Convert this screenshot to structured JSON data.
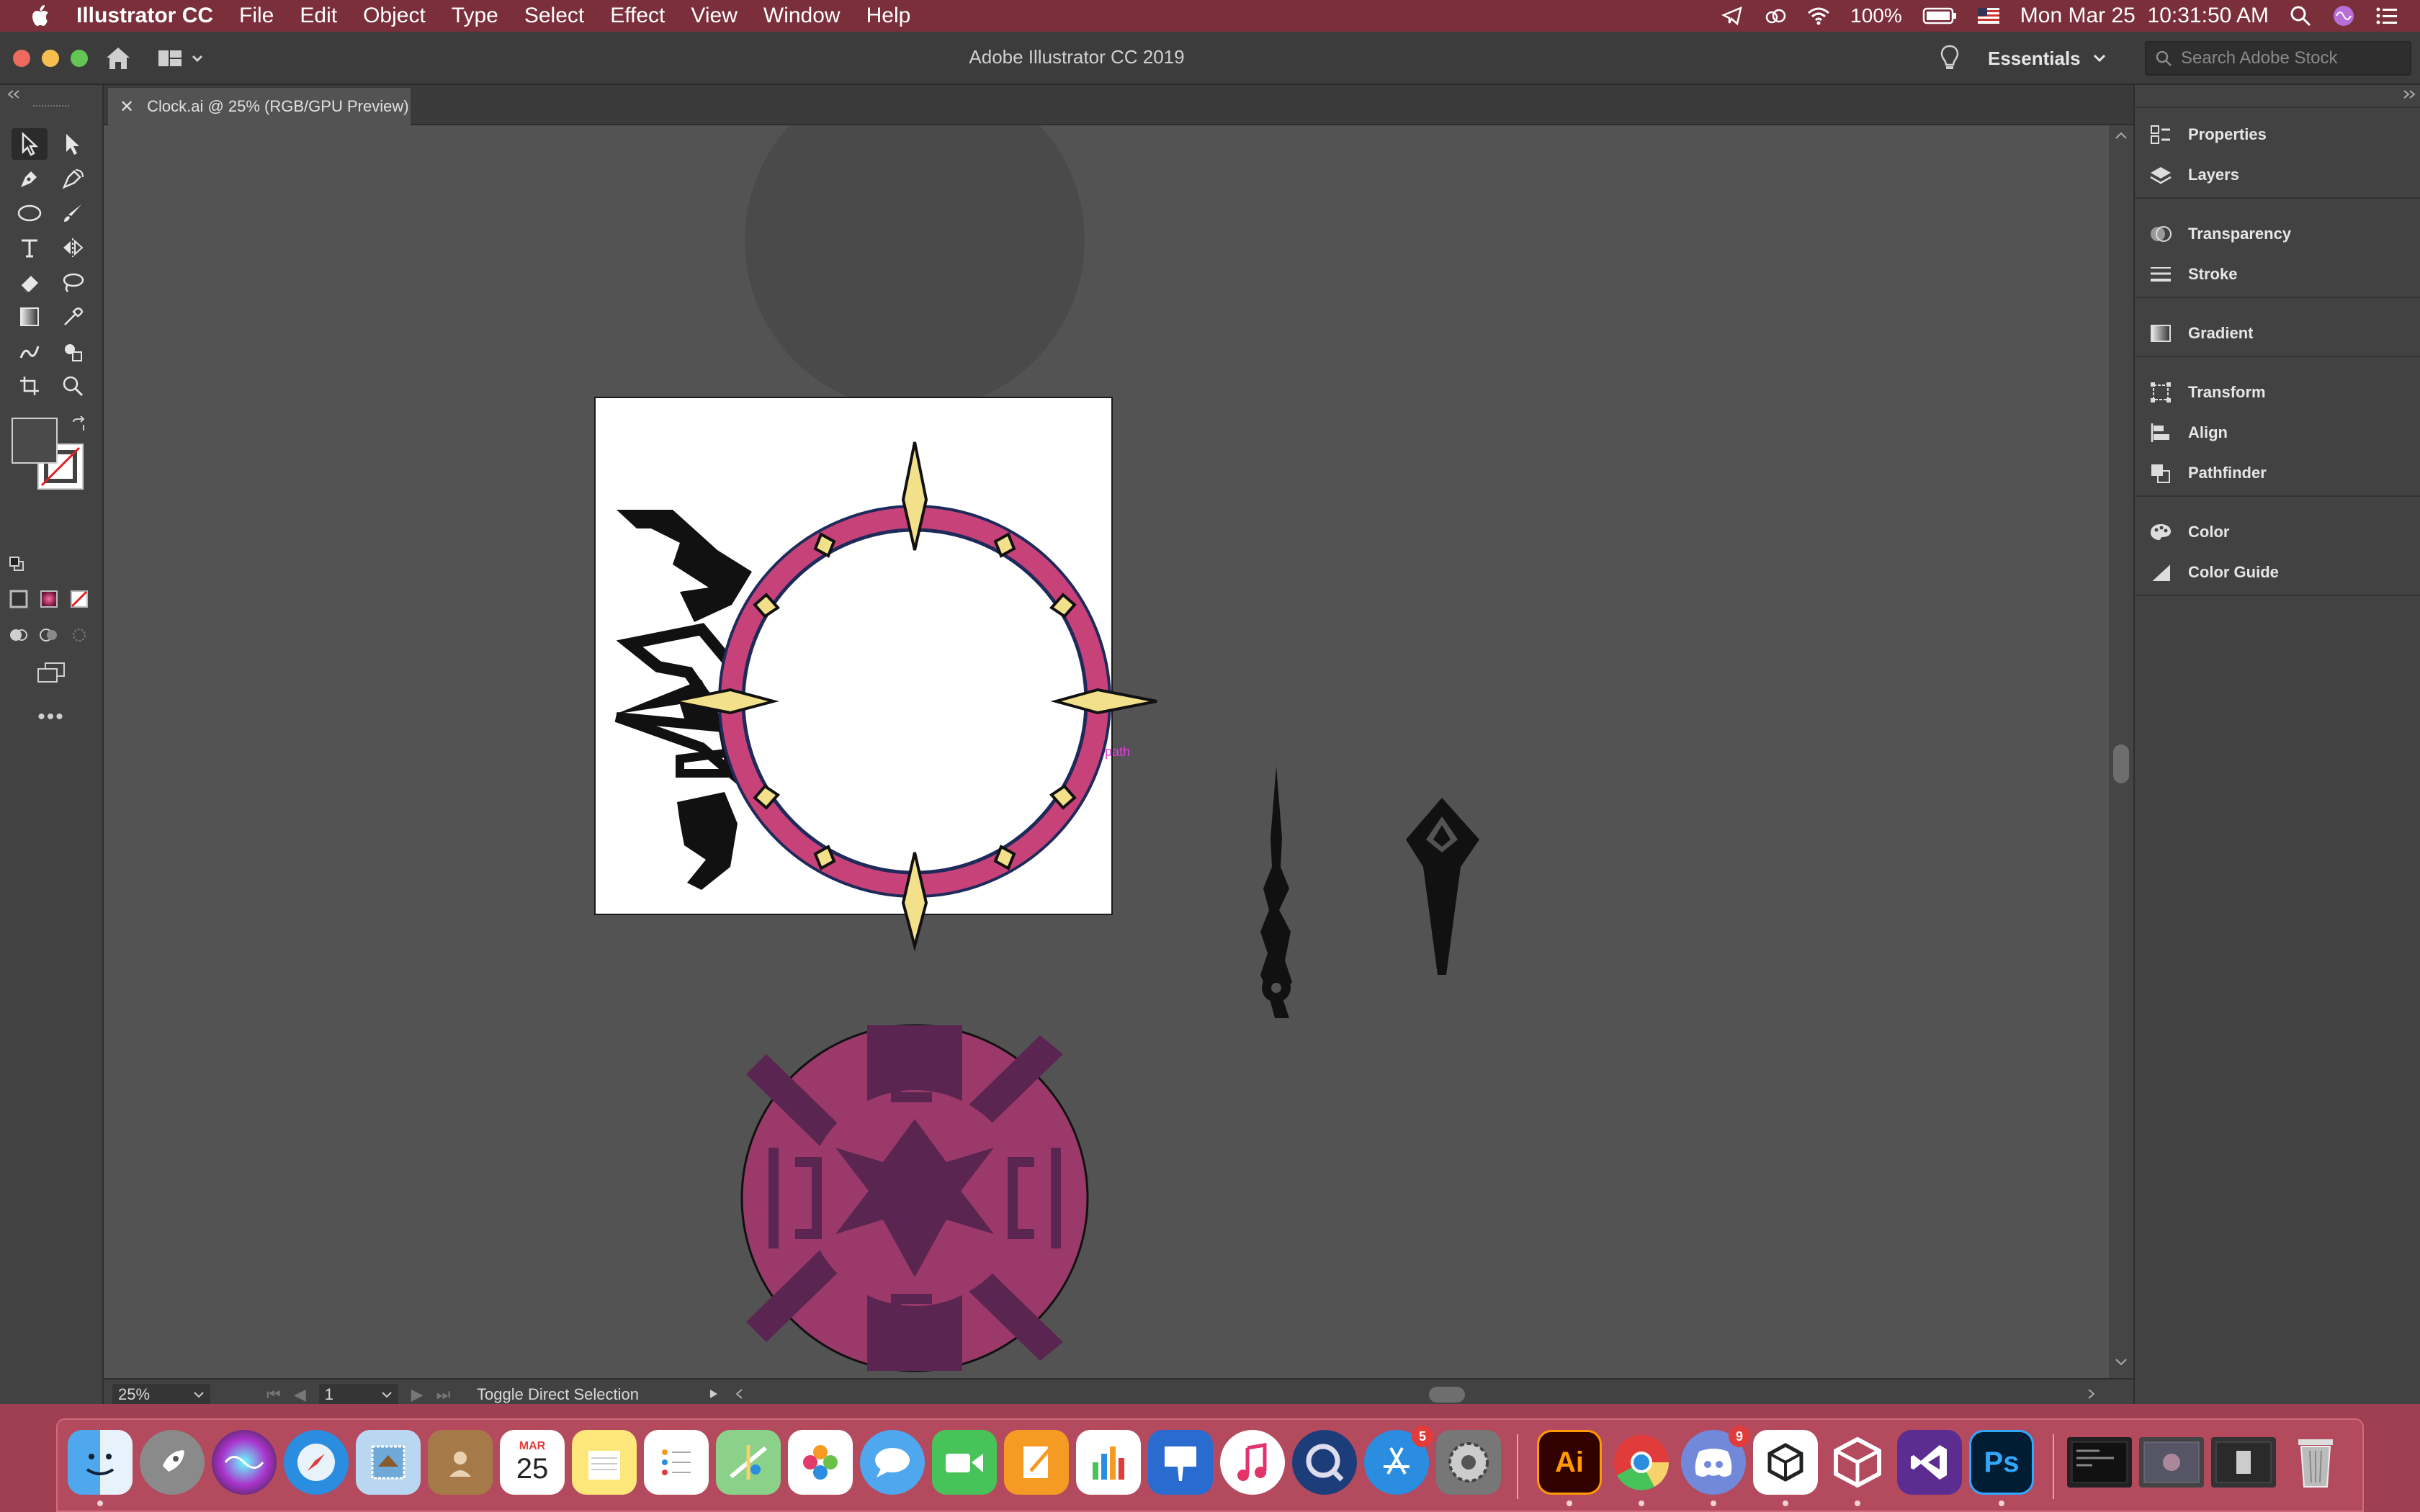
{
  "menubar": {
    "app_name": "Illustrator CC",
    "menus": [
      "File",
      "Edit",
      "Object",
      "Type",
      "Select",
      "Effect",
      "View",
      "Window",
      "Help"
    ],
    "battery": "100%",
    "datetime": "Mon Mar 25  10:31:50 AM"
  },
  "window": {
    "title": "Adobe Illustrator CC 2019",
    "workspace": "Essentials",
    "search_placeholder": "Search Adobe Stock"
  },
  "document": {
    "tab_label": "Clock.ai @ 25% (RGB/GPU Preview)",
    "canvas_hint": "path"
  },
  "statusbar": {
    "zoom": "25%",
    "artboard_number": "1",
    "status_text": "Toggle Direct Selection"
  },
  "panels": [
    {
      "label": "Properties",
      "icon": "properties-icon"
    },
    {
      "label": "Layers",
      "icon": "layers-icon"
    },
    {
      "label": "Transparency",
      "icon": "transparency-icon"
    },
    {
      "label": "Stroke",
      "icon": "stroke-icon"
    },
    {
      "label": "Gradient",
      "icon": "gradient-icon"
    },
    {
      "label": "Transform",
      "icon": "transform-icon"
    },
    {
      "label": "Align",
      "icon": "align-icon"
    },
    {
      "label": "Pathfinder",
      "icon": "pathfinder-icon"
    },
    {
      "label": "Color",
      "icon": "color-icon"
    },
    {
      "label": "Color Guide",
      "icon": "color-guide-icon"
    }
  ],
  "dock": {
    "calendar_month": "MAR",
    "calendar_day": "25",
    "illustrator_label": "Ai",
    "photoshop_label": "Ps",
    "appstore_badge": "5",
    "discord_badge": "9"
  },
  "colors": {
    "menubar": "#7a2f3b",
    "dock": "#b34a5e",
    "clock_ring": "#c8427a",
    "clock_gold": "#f2e08a",
    "medallion_light": "#9b3a6a",
    "medallion_dark": "#5a2550"
  }
}
